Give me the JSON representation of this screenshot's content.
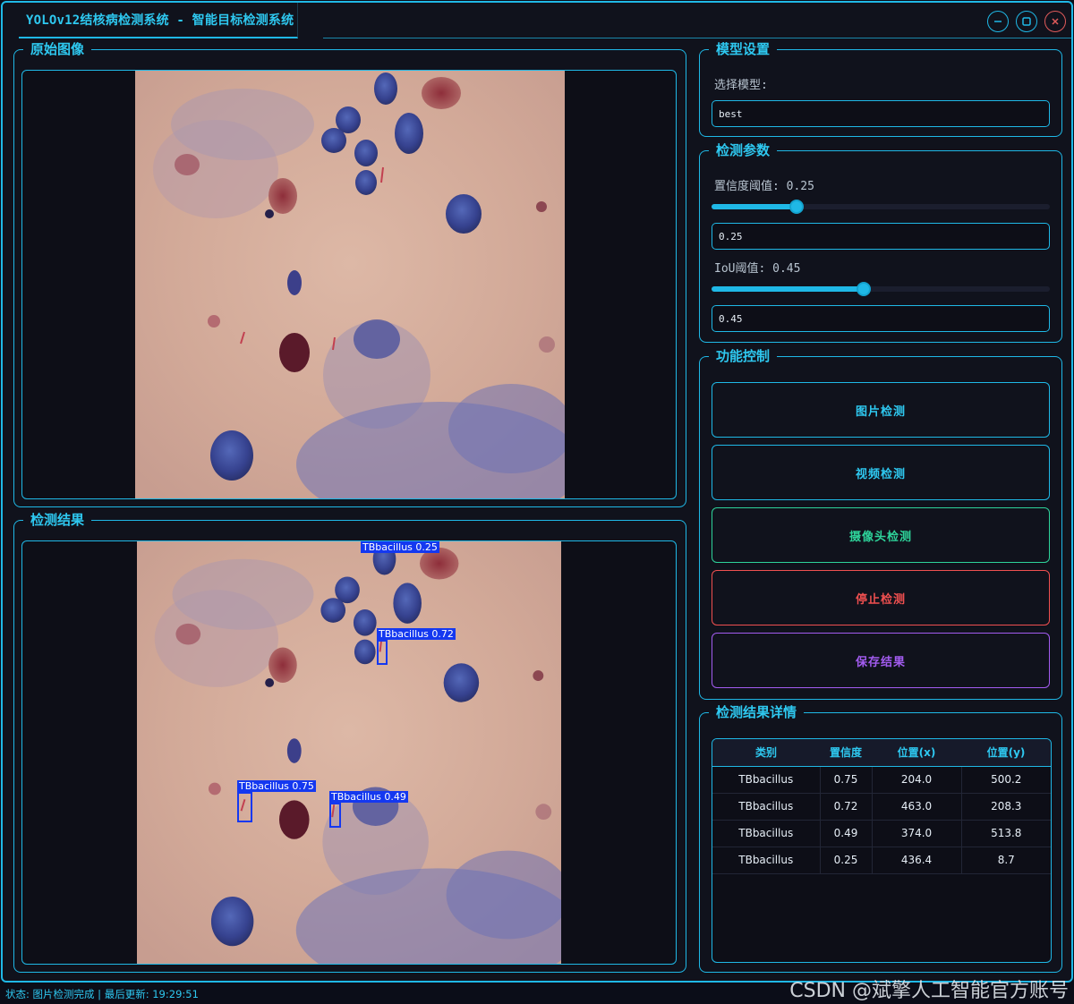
{
  "window": {
    "title": "YOLOv12结核病检测系统 - 智能目标检测系统"
  },
  "panels": {
    "original": "原始图像",
    "result": "检测结果",
    "model": "模型设置",
    "params": "检测参数",
    "control": "功能控制",
    "details": "检测结果详情"
  },
  "model": {
    "select_label": "选择模型:",
    "selected": "best"
  },
  "params": {
    "conf_label": "置信度阈值: 0.25",
    "conf_value": "0.25",
    "conf_fraction": 0.25,
    "iou_label": "IoU阈值: 0.45",
    "iou_value": "0.45",
    "iou_fraction": 0.45
  },
  "buttons": {
    "image": "图片检测",
    "video": "视频检测",
    "camera": "摄像头检测",
    "stop": "停止检测",
    "save": "保存结果"
  },
  "colors": {
    "accent": "#1fb8e6",
    "image_btn": "#2ec8f0",
    "camera_btn": "#2ed39a",
    "stop_btn": "#f05050",
    "save_btn": "#a35cf0",
    "bbox": "#1438f0"
  },
  "detections": [
    {
      "label": "TBbacillus 0.25"
    },
    {
      "label": "TBbacillus 0.72"
    },
    {
      "label": "TBbacillus 0.75"
    },
    {
      "label": "TBbacillus 0.49"
    }
  ],
  "table": {
    "headers": [
      "类别",
      "置信度",
      "位置(x)",
      "位置(y)"
    ],
    "rows": [
      [
        "TBbacillus",
        "0.75",
        "204.0",
        "500.2"
      ],
      [
        "TBbacillus",
        "0.72",
        "463.0",
        "208.3"
      ],
      [
        "TBbacillus",
        "0.49",
        "374.0",
        "513.8"
      ],
      [
        "TBbacillus",
        "0.25",
        "436.4",
        "8.7"
      ]
    ]
  },
  "status": {
    "text": "状态: 图片检测完成 | 最后更新: 19:29:51"
  },
  "watermark": "CSDN @斌擎人工智能官方账号"
}
